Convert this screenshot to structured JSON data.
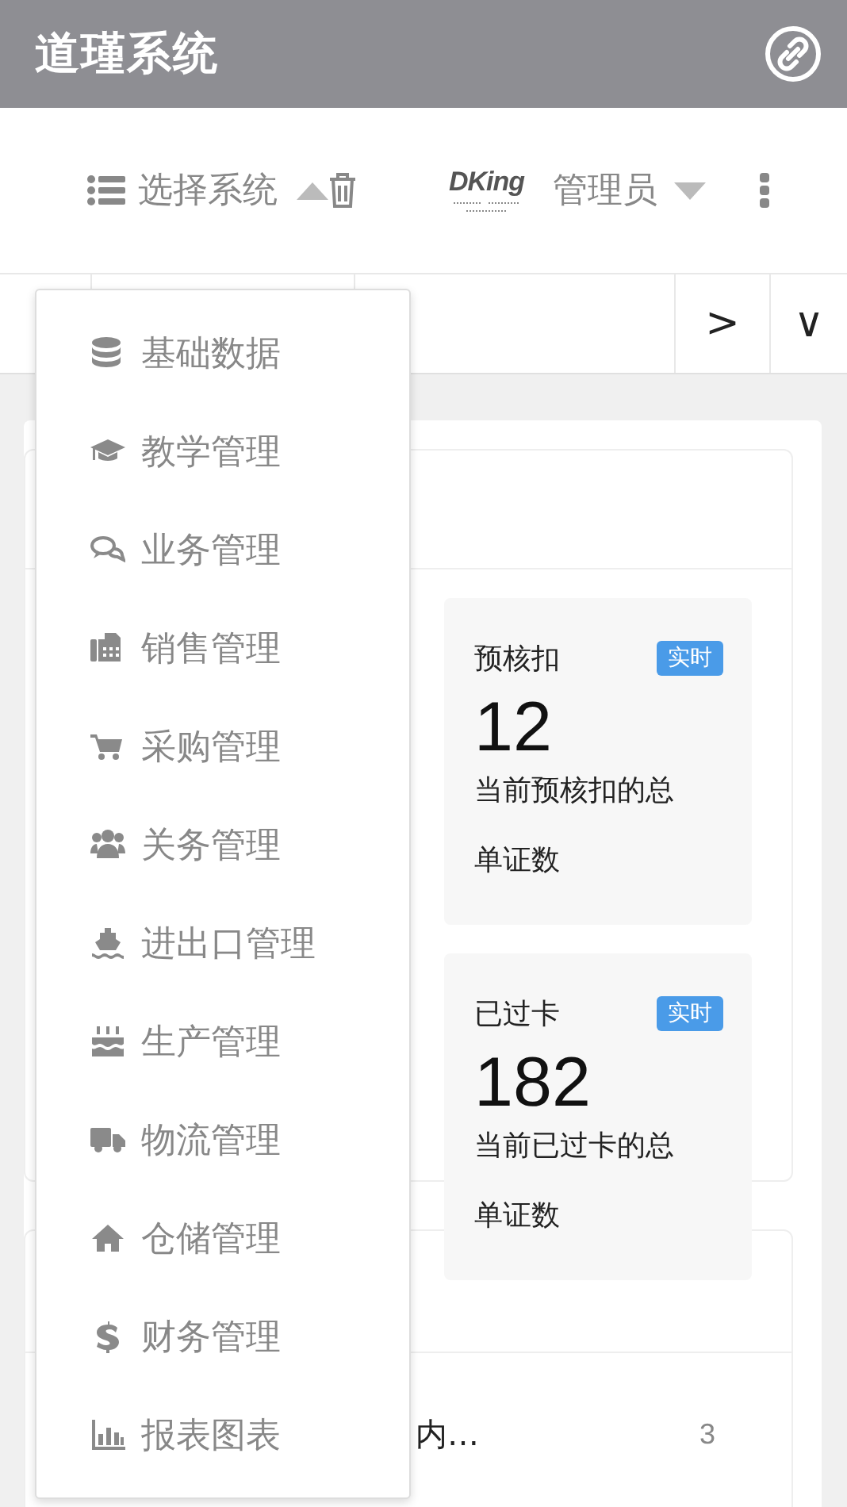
{
  "app_title": "道瑾系统",
  "header": {
    "system_select": "选择系统",
    "logo_text": "DKing",
    "user": "管理员"
  },
  "tab_bar": {
    "next": ">",
    "expand": "∨"
  },
  "system_menu": [
    {
      "label": "基础数据"
    },
    {
      "label": "教学管理"
    },
    {
      "label": "业务管理"
    },
    {
      "label": "销售管理"
    },
    {
      "label": "采购管理"
    },
    {
      "label": "关务管理"
    },
    {
      "label": "进出口管理"
    },
    {
      "label": "生产管理"
    },
    {
      "label": "物流管理"
    },
    {
      "label": "仓储管理"
    },
    {
      "label": "财务管理"
    },
    {
      "label": "报表图表"
    }
  ],
  "stats": [
    {
      "title": "预核扣",
      "badge": "实时",
      "value": "12",
      "description": "当前预核扣的总单证数"
    },
    {
      "title": "已过卡",
      "badge": "实时",
      "value": "182",
      "description": "当前已过卡的总单证数"
    }
  ],
  "list": [
    {
      "text": "内…",
      "count": "3"
    }
  ]
}
